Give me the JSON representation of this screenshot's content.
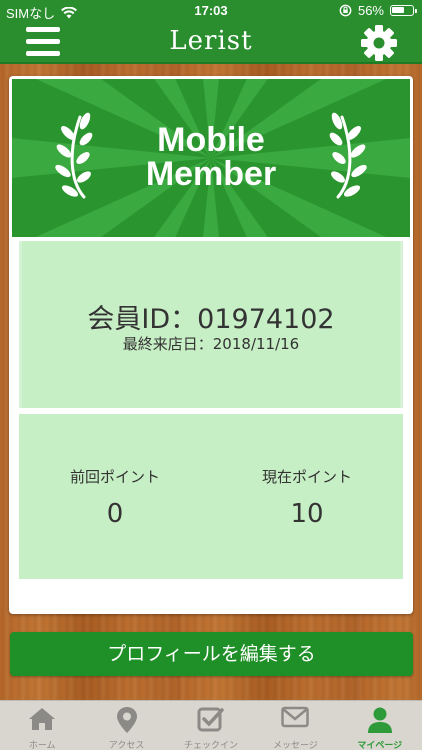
{
  "status": {
    "carrier": "SIMなし",
    "time": "17:03",
    "battery": "56%"
  },
  "header": {
    "title": "Lerist",
    "menu_icon": "hamburger-icon",
    "settings_icon": "gear-icon"
  },
  "banner": {
    "line1": "Mobile",
    "line2": "Member"
  },
  "member": {
    "id_label": "会員ID：01974102",
    "last_visit": "最終来店日：2018/11/16"
  },
  "points": {
    "previous_label": "前回ポイント",
    "previous_value": "0",
    "current_label": "現在ポイント",
    "current_value": "10"
  },
  "edit_button": "プロフィールを編集する",
  "tabs": [
    {
      "label": "ホーム",
      "icon": "home-icon",
      "active": false
    },
    {
      "label": "アクセス",
      "icon": "map-pin-icon",
      "active": false
    },
    {
      "label": "チェックイン",
      "icon": "checkbox-icon",
      "active": false
    },
    {
      "label": "メッセージ",
      "icon": "envelope-icon",
      "active": false
    },
    {
      "label": "マイページ",
      "icon": "user-icon",
      "active": true
    }
  ],
  "colors": {
    "brand_green": "#2a8e2f",
    "panel_green": "#c7efc5",
    "active_tab": "#2f9a3a"
  }
}
